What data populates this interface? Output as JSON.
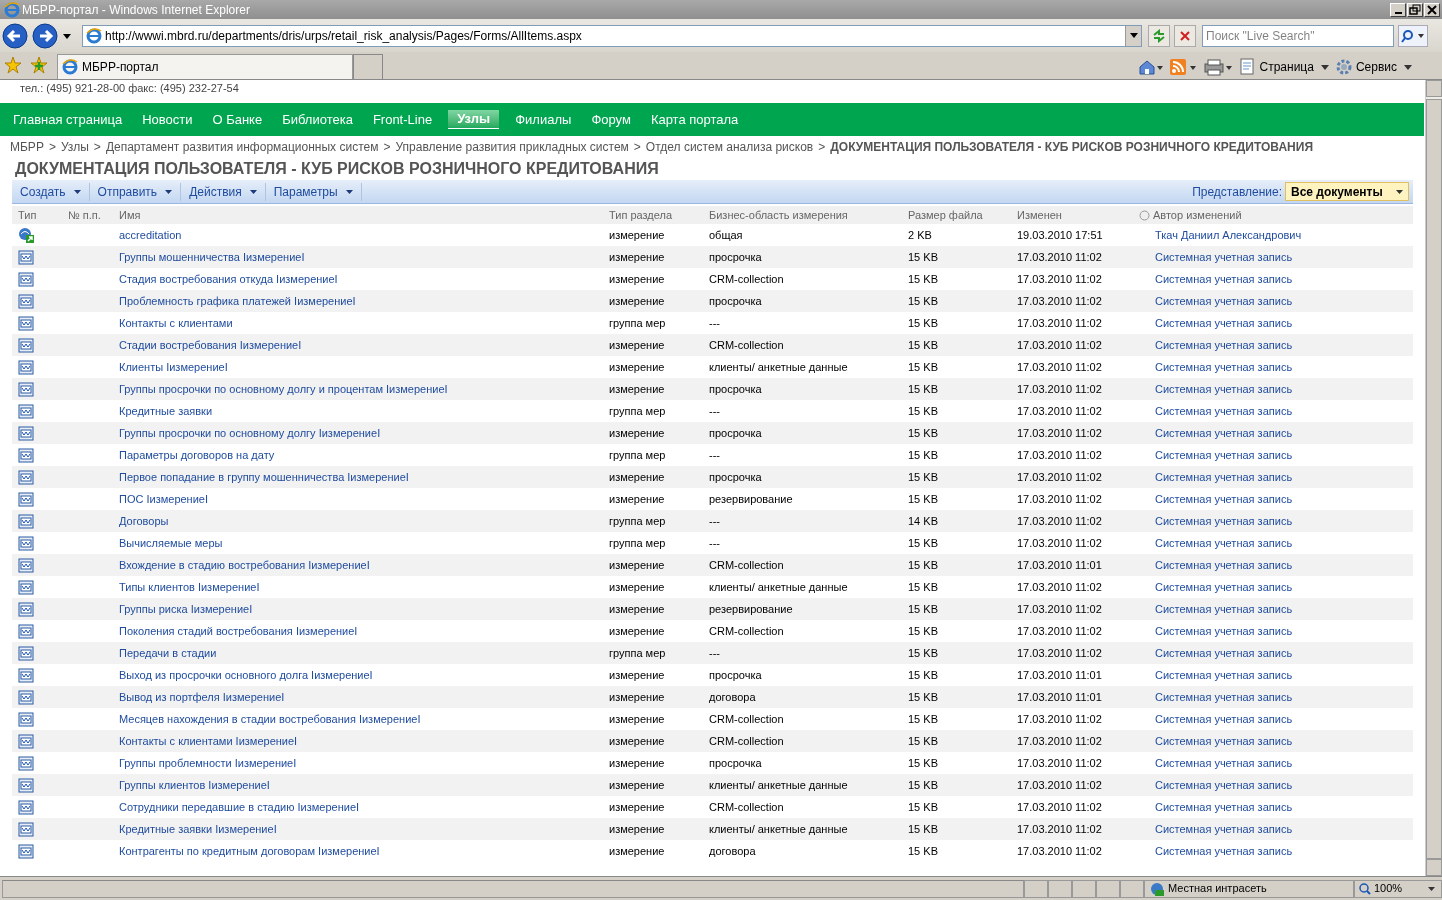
{
  "window": {
    "title": "МБРР-портал - Windows Internet Explorer"
  },
  "address": "http://wwwi.mbrd.ru/departments/dris/urps/retail_risk_analysis/Pages/Forms/AllItems.aspx",
  "search": {
    "placeholder": "Поиск \"Live Search\""
  },
  "tab": {
    "label": "МБРР-портал"
  },
  "command_bar": [
    "Страница",
    "Сервис"
  ],
  "contacts": "тел.: (495) 921-28-00  факс: (495) 232-27-54",
  "nav": [
    {
      "label": "Главная страница",
      "selected": false
    },
    {
      "label": "Новости",
      "selected": false
    },
    {
      "label": "О Банке",
      "selected": false
    },
    {
      "label": "Библиотека",
      "selected": false
    },
    {
      "label": "Front-Line",
      "selected": false
    },
    {
      "label": "Узлы",
      "selected": true
    },
    {
      "label": "Филиалы",
      "selected": false
    },
    {
      "label": "Форум",
      "selected": false
    },
    {
      "label": "Карта портала",
      "selected": false
    }
  ],
  "breadcrumb_separator": ">",
  "breadcrumb": [
    "МБРР",
    "Узлы",
    "Департамент развития информационных систем",
    "Управление развития прикладных систем",
    "Отдел систем анализа рисков",
    "ДОКУМЕНТАЦИЯ ПОЛЬЗОВАТЕЛЯ - КУБ РИСКОВ РОЗНИЧНОГО КРЕДИТОВАНИЯ"
  ],
  "page_title": "ДОКУМЕНТАЦИЯ ПОЛЬЗОВАТЕЛЯ - КУБ РИСКОВ РОЗНИЧНОГО КРЕДИТОВАНИЯ",
  "toolbar": [
    "Создать",
    "Отправить",
    "Действия",
    "Параметры"
  ],
  "view": {
    "label": "Представление:",
    "value": "Все документы"
  },
  "table": {
    "columns": [
      "Тип",
      "№ п.п.",
      "Имя",
      "Тип раздела",
      "Бизнес-область измерения",
      "Размер файла",
      "Изменен",
      "Автор изменений"
    ],
    "rows": [
      {
        "kind": "shortcut",
        "name": "accreditation",
        "section": "измерение",
        "area": "общая",
        "size": "2 KB",
        "modified": "19.03.2010 17:51",
        "author": "Ткач Даниил Александрович"
      },
      {
        "kind": "document",
        "name": "Группы мошенничества IизмерениеI",
        "section": "измерение",
        "area": "просрочка",
        "size": "15 KB",
        "modified": "17.03.2010 11:02",
        "author": "Системная учетная запись"
      },
      {
        "kind": "document",
        "name": "Стадия востребования откуда IизмерениеI",
        "section": "измерение",
        "area": "CRM-collection",
        "size": "15 KB",
        "modified": "17.03.2010 11:02",
        "author": "Системная учетная запись"
      },
      {
        "kind": "document",
        "name": "Проблемность графика платежей IизмерениеI",
        "section": "измерение",
        "area": "просрочка",
        "size": "15 KB",
        "modified": "17.03.2010 11:02",
        "author": "Системная учетная запись"
      },
      {
        "kind": "document",
        "name": "Контакты с клиентами",
        "section": "группа мер",
        "area": "---",
        "size": "15 KB",
        "modified": "17.03.2010 11:02",
        "author": "Системная учетная запись"
      },
      {
        "kind": "document",
        "name": "Стадии востребования IизмерениеI",
        "section": "измерение",
        "area": "CRM-collection",
        "size": "15 KB",
        "modified": "17.03.2010 11:02",
        "author": "Системная учетная запись"
      },
      {
        "kind": "document",
        "name": "Клиенты IизмерениеI",
        "section": "измерение",
        "area": "клиенты/ анкетные данные",
        "size": "15 KB",
        "modified": "17.03.2010 11:02",
        "author": "Системная учетная запись"
      },
      {
        "kind": "document",
        "name": "Группы просрочки по основному долгу и процентам IизмерениеI",
        "section": "измерение",
        "area": "просрочка",
        "size": "15 KB",
        "modified": "17.03.2010 11:02",
        "author": "Системная учетная запись"
      },
      {
        "kind": "document",
        "name": "Кредитные заявки",
        "section": "группа мер",
        "area": "---",
        "size": "15 KB",
        "modified": "17.03.2010 11:02",
        "author": "Системная учетная запись"
      },
      {
        "kind": "document",
        "name": "Группы просрочки по основному долгу IизмерениеI",
        "section": "измерение",
        "area": "просрочка",
        "size": "15 KB",
        "modified": "17.03.2010 11:02",
        "author": "Системная учетная запись"
      },
      {
        "kind": "document",
        "name": "Параметры договоров на дату",
        "section": "группа мер",
        "area": "---",
        "size": "15 KB",
        "modified": "17.03.2010 11:02",
        "author": "Системная учетная запись"
      },
      {
        "kind": "document",
        "name": "Первое попадание в группу мошенничества IизмерениеI",
        "section": "измерение",
        "area": "просрочка",
        "size": "15 KB",
        "modified": "17.03.2010 11:02",
        "author": "Системная учетная запись"
      },
      {
        "kind": "document",
        "name": "ПОС IизмерениеI",
        "section": "измерение",
        "area": "резервирование",
        "size": "15 KB",
        "modified": "17.03.2010 11:02",
        "author": "Системная учетная запись"
      },
      {
        "kind": "document",
        "name": "Договоры",
        "section": "группа мер",
        "area": "---",
        "size": "14 KB",
        "modified": "17.03.2010 11:02",
        "author": "Системная учетная запись"
      },
      {
        "kind": "document",
        "name": "Вычисляемые меры",
        "section": "группа мер",
        "area": "---",
        "size": "15 KB",
        "modified": "17.03.2010 11:02",
        "author": "Системная учетная запись"
      },
      {
        "kind": "document",
        "name": "Вхождение в стадию востребования IизмерениеI",
        "section": "измерение",
        "area": "CRM-collection",
        "size": "15 KB",
        "modified": "17.03.2010 11:01",
        "author": "Системная учетная запись"
      },
      {
        "kind": "document",
        "name": "Типы клиентов IизмерениеI",
        "section": "измерение",
        "area": "клиенты/ анкетные данные",
        "size": "15 KB",
        "modified": "17.03.2010 11:02",
        "author": "Системная учетная запись"
      },
      {
        "kind": "document",
        "name": "Группы риска IизмерениеI",
        "section": "измерение",
        "area": "резервирование",
        "size": "15 KB",
        "modified": "17.03.2010 11:02",
        "author": "Системная учетная запись"
      },
      {
        "kind": "document",
        "name": "Поколения стадий востребования IизмерениеI",
        "section": "измерение",
        "area": "CRM-collection",
        "size": "15 KB",
        "modified": "17.03.2010 11:02",
        "author": "Системная учетная запись"
      },
      {
        "kind": "document",
        "name": "Передачи в стадии",
        "section": "группа мер",
        "area": "---",
        "size": "15 KB",
        "modified": "17.03.2010 11:02",
        "author": "Системная учетная запись"
      },
      {
        "kind": "document",
        "name": "Выход из просрочки основного долга IизмерениеI",
        "section": "измерение",
        "area": "просрочка",
        "size": "15 KB",
        "modified": "17.03.2010 11:01",
        "author": "Системная учетная запись"
      },
      {
        "kind": "document",
        "name": "Вывод из портфеля IизмерениеI",
        "section": "измерение",
        "area": "договора",
        "size": "15 KB",
        "modified": "17.03.2010 11:01",
        "author": "Системная учетная запись"
      },
      {
        "kind": "document",
        "name": "Месяцев нахождения в стадии востребования IизмерениеI",
        "section": "измерение",
        "area": "CRM-collection",
        "size": "15 KB",
        "modified": "17.03.2010 11:02",
        "author": "Системная учетная запись"
      },
      {
        "kind": "document",
        "name": "Контакты с клиентами IизмерениеI",
        "section": "измерение",
        "area": "CRM-collection",
        "size": "15 KB",
        "modified": "17.03.2010 11:02",
        "author": "Системная учетная запись"
      },
      {
        "kind": "document",
        "name": "Группы проблемности IизмерениеI",
        "section": "измерение",
        "area": "просрочка",
        "size": "15 KB",
        "modified": "17.03.2010 11:02",
        "author": "Системная учетная запись"
      },
      {
        "kind": "document",
        "name": "Группы клиентов IизмерениеI",
        "section": "измерение",
        "area": "клиенты/ анкетные данные",
        "size": "15 KB",
        "modified": "17.03.2010 11:02",
        "author": "Системная учетная запись"
      },
      {
        "kind": "document",
        "name": "Сотрудники передавшие в стадию IизмерениеI",
        "section": "измерение",
        "area": "CRM-collection",
        "size": "15 KB",
        "modified": "17.03.2010 11:02",
        "author": "Системная учетная запись"
      },
      {
        "kind": "document",
        "name": "Кредитные заявки IизмерениеI",
        "section": "измерение",
        "area": "клиенты/ анкетные данные",
        "size": "15 KB",
        "modified": "17.03.2010 11:02",
        "author": "Системная учетная запись"
      },
      {
        "kind": "document",
        "name": "Контрагенты по кредитным договорам IизмерениеI",
        "section": "измерение",
        "area": "договора",
        "size": "15 KB",
        "modified": "17.03.2010 11:02",
        "author": "Системная учетная запись"
      }
    ]
  },
  "status_bar": {
    "zone": "Местная интрасеть",
    "zoom": "100%"
  }
}
